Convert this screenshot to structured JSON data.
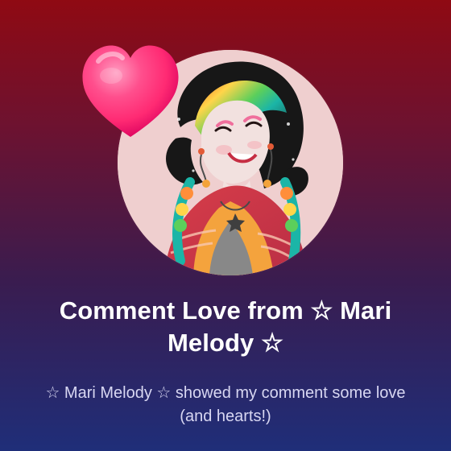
{
  "card": {
    "title": "Comment Love from ☆ Mari Melody ☆",
    "subtitle": "☆ Mari Melody ☆ showed my comment some love (and hearts!)"
  },
  "icons": {
    "heart": "heart-icon",
    "avatar": "avatar-illustration"
  },
  "colors": {
    "background_top": "#8f0a13",
    "background_bottom": "#1f2e79",
    "heart": "#ff2a73",
    "title_text": "#ffffff",
    "subtitle_text": "#d8d7f2"
  }
}
